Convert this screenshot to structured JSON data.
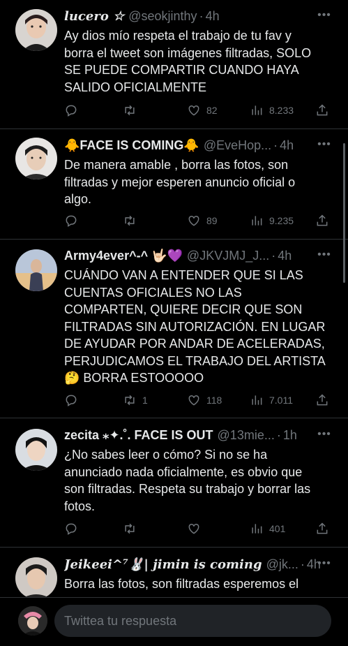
{
  "tweets": [
    {
      "name": "lucero ☆",
      "handle": "@seokjinthy",
      "dot": "·",
      "time": "4h",
      "lines": [
        "Ay dios mío respeta el trabajo de tu fav y",
        "borra el tweet son imágenes filtradas, SOLO",
        "SE PUEDE COMPARTIR CUANDO HAYA",
        "SALIDO OFICIALMENTE"
      ],
      "retweets": "",
      "likes": "82",
      "views": "8.233"
    },
    {
      "name": "🐥FACE IS COMING🐥",
      "handle": "@EveHop...",
      "dot": "·",
      "time": "4h",
      "lines": [
        "De manera amable ,  borra las fotos, son",
        "filtradas y mejor esperen anuncio oficial o",
        "algo."
      ],
      "retweets": "",
      "likes": "89",
      "views": "9.235"
    },
    {
      "name": "Army4ever^-^ 🤟🏻💜",
      "handle": "@JKVJMJ_J...",
      "dot": "·",
      "time": "4h",
      "lines": [
        "CUÁNDO VAN A ENTENDER QUE SI LAS",
        "CUENTAS OFICIALES NO LAS",
        "COMPARTEN, QUIERE DECIR QUE SON",
        "FILTRADAS SIN AUTORIZACIÓN. EN LUGAR",
        "DE AYUDAR POR ANDAR DE ACELERADAS,",
        "PERJUDICAMOS EL TRABAJO DEL ARTISTA",
        "🤔 BORRA ESTOOOOO"
      ],
      "retweets": "1",
      "likes": "118",
      "views": "7.011"
    },
    {
      "name": "zecita ⁎✦.˚. FACE IS OUT",
      "handle": "@13mie...",
      "dot": "·",
      "time": "1h",
      "lines": [
        "¿No sabes leer o cómo? Si no se ha",
        "anunciado nada oficialmente, es obvio que",
        "son filtradas. Respeta su trabajo y borrar las",
        "fotos."
      ],
      "retweets": "",
      "likes": "",
      "views": "401"
    },
    {
      "name": "Jeikeei^⁷🐰| jimin is coming",
      "handle": "@jk...",
      "dot": "·",
      "time": "4h",
      "lines": [
        "Borra las fotos, son filtradas esperemos el"
      ]
    }
  ],
  "reply": {
    "placeholder": "Twittea tu respuesta"
  },
  "icons": {
    "reply": "reply-icon",
    "retweet": "retweet-icon",
    "like": "heart-icon",
    "views": "views-icon",
    "share": "share-icon",
    "more": "more-icon"
  },
  "colors": {
    "background": "#000000",
    "text": "#e7e9ea",
    "muted": "#71767b",
    "divider": "#2f3336",
    "input_bg": "#202327"
  }
}
